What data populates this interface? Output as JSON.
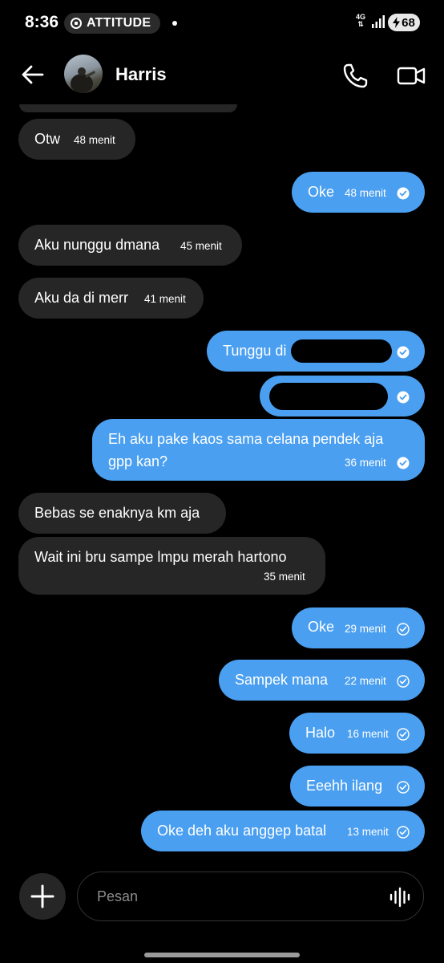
{
  "status_bar": {
    "time": "8:36",
    "attitude_label": "ATTITUDE",
    "network_type": "4G",
    "battery": "68"
  },
  "header": {
    "contact_name": "Harris"
  },
  "messages": [
    {
      "side": "in",
      "text": "Otw",
      "time": "48 menit"
    },
    {
      "side": "out",
      "text": "Oke",
      "time": "48 menit",
      "status": "read"
    },
    {
      "side": "in",
      "text": "Aku nunggu dmana",
      "time": "45 menit"
    },
    {
      "side": "in",
      "text": "Aku da di merr",
      "time": "41 menit"
    },
    {
      "side": "out",
      "text": "Tunggu di",
      "time": "",
      "status": "read"
    },
    {
      "side": "out",
      "text": "",
      "time": "",
      "status": "read"
    },
    {
      "side": "out",
      "text": "Eh aku pake kaos sama celana pendek aja",
      "text_line2": "gpp kan?",
      "time": "36 menit",
      "status": "read"
    },
    {
      "side": "in",
      "text": "Bebas se enaknya km aja",
      "time": ""
    },
    {
      "side": "in",
      "text": "Wait ini bru sampe lmpu merah hartono",
      "time": "35 menit"
    },
    {
      "side": "out",
      "text": "Oke",
      "time": "29 menit",
      "status": "delivered"
    },
    {
      "side": "out",
      "text": "Sampek mana",
      "time": "22 menit",
      "status": "delivered"
    },
    {
      "side": "out",
      "text": "Halo",
      "time": "16 menit",
      "status": "delivered"
    },
    {
      "side": "out",
      "text": "Eeehh ilang",
      "time": "",
      "status": "delivered"
    },
    {
      "side": "out",
      "text": "Oke deh aku anggep batal",
      "time": "13 menit",
      "status": "delivered"
    }
  ],
  "composer": {
    "placeholder": "Pesan"
  },
  "colors": {
    "outgoing_bubble": "#4a9ff0",
    "incoming_bubble": "#262626",
    "background": "#000000"
  },
  "icons": [
    "back-arrow-icon",
    "phone-icon",
    "video-camera-icon",
    "plus-icon",
    "voice-waveform-icon",
    "read-check-icon",
    "delivered-check-icon"
  ]
}
